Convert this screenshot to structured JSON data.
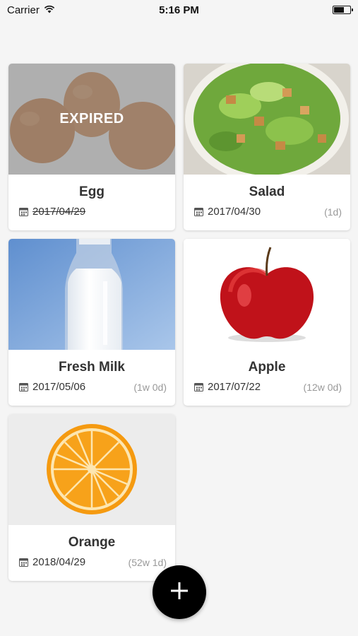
{
  "status_bar": {
    "carrier": "Carrier",
    "time": "5:16 PM",
    "battery_level": 0.65
  },
  "items": [
    {
      "name": "Egg",
      "date": "2017/04/29",
      "remaining": "",
      "expired": true,
      "overlay_text": "EXPIRED",
      "image_icon": "eggs-photo"
    },
    {
      "name": "Salad",
      "date": "2017/04/30",
      "remaining": "(1d)",
      "expired": false,
      "image_icon": "salad-photo"
    },
    {
      "name": "Fresh Milk",
      "date": "2017/05/06",
      "remaining": "(1w 0d)",
      "expired": false,
      "image_icon": "milk-bottle-photo"
    },
    {
      "name": "Apple",
      "date": "2017/07/22",
      "remaining": "(12w 0d)",
      "expired": false,
      "image_icon": "apple-photo"
    },
    {
      "name": "Orange",
      "date": "2018/04/29",
      "remaining": "(52w 1d)",
      "expired": false,
      "image_icon": "orange-photo"
    }
  ],
  "fab": {
    "icon": "plus-icon"
  },
  "colors": {
    "background": "#f5f5f5",
    "fab": "#000000",
    "muted_text": "#999999"
  }
}
